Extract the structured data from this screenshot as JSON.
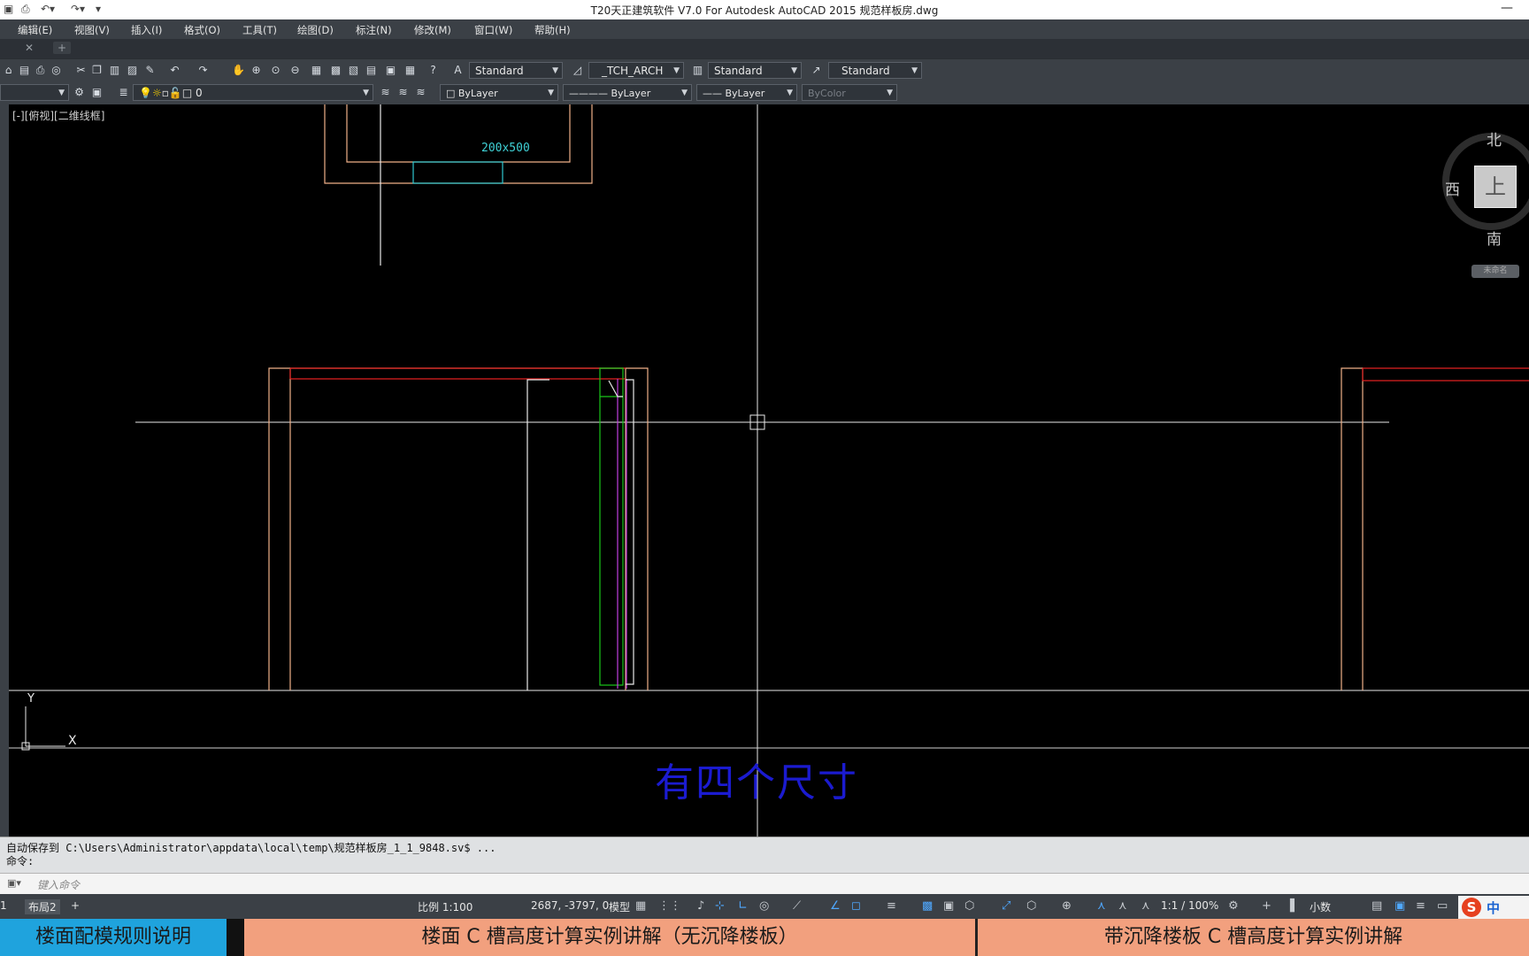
{
  "window": {
    "title": "T20天正建筑软件 V7.0 For Autodesk AutoCAD 2015    规范样板房.dwg",
    "minimize": "—"
  },
  "menu": [
    "编辑(E)",
    "视图(V)",
    "插入(I)",
    "格式(O)",
    "工具(T)",
    "绘图(D)",
    "标注(N)",
    "修改(M)",
    "窗口(W)",
    "帮助(H)"
  ],
  "tabs": {
    "close": "✕",
    "add": "+"
  },
  "toolbar": {
    "text_style": "Standard",
    "dim_style": "_TCH_ARCH",
    "table_style": "Standard",
    "mleader_style": "Standard",
    "layer": "0",
    "color": "ByLayer",
    "linetype": "ByLayer",
    "lineweight": "ByLayer",
    "plotstyle": "ByColor"
  },
  "viewport": {
    "label": "[-][俯视][二维线框]",
    "dimension_text": "200x500",
    "annotation": "有四个尺寸",
    "ucs_x": "X",
    "ucs_y": "Y"
  },
  "viewcube": {
    "north": "北",
    "west": "西",
    "south": "南",
    "face": "上",
    "ucs": "未命名"
  },
  "command": {
    "line1": "自动保存到 C:\\Users\\Administrator\\appdata\\local\\temp\\规范样板房_1_1_9848.sv$ ...",
    "line2": "命令:",
    "placeholder": "键入命令"
  },
  "layout_tabs": [
    "1",
    "布局2"
  ],
  "status": {
    "scale": "比例 1:100",
    "coords": "2687, -3797, 0",
    "model": "模型",
    "anno_scale": "1:1 / 100%",
    "units": "小数"
  },
  "ime": {
    "label": "中"
  },
  "banner": [
    {
      "text": "楼面配模规则说明",
      "bg": "#1fa3dd"
    },
    {
      "text": "楼面 C 槽高度计算实例讲解（无沉降楼板）",
      "bg": "#f2a07e"
    },
    {
      "text": "带沉降楼板 C 槽高度计算实例讲解",
      "bg": "#f2a07e"
    }
  ],
  "colors": {
    "red": "#e02020",
    "tan": "#f0b088",
    "green": "#19c619",
    "magenta": "#c040e0",
    "cyan": "#2fc8d0",
    "white": "#e8e8e8"
  }
}
